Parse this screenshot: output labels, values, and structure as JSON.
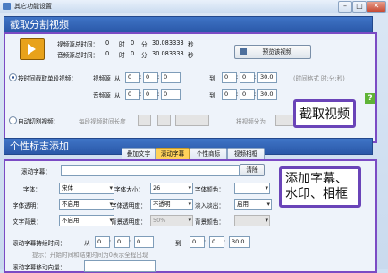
{
  "window": {
    "title": "其它功能设置",
    "min": "–",
    "max": "□",
    "close": "✕"
  },
  "clip": {
    "header": "截取分割视频",
    "video_total_label": "视频源总时间：",
    "video_total": {
      "h": "0",
      "m": "0",
      "s": "30.083333"
    },
    "audio_total_label": "音频源总时间：",
    "audio_total": {
      "h": "0",
      "m": "0",
      "s": "30.083333"
    },
    "unit_h": "时",
    "unit_m": "分",
    "unit_s": "秒",
    "preview_button": "预览该视频",
    "by_time_label": "按时间截取单段视频：",
    "video_src": "视频源",
    "audio_src": "音频源",
    "from": "从",
    "to": "到",
    "video_from": [
      "0",
      "0",
      "0"
    ],
    "video_to": [
      "0",
      "0",
      "30.0"
    ],
    "audio_from": [
      "0",
      "0",
      "0"
    ],
    "audio_to": [
      "0",
      "0",
      "30.0"
    ],
    "time_format_hint": "(时间格式 时:分:秒)",
    "auto_split_label": "自动切割视频：",
    "segment_length_label": "每段视频时间长度",
    "segment_count_label": "将视频分为",
    "segment_unit": "段",
    "callout": "截取视频"
  },
  "logo": {
    "header": "个性标志添加",
    "tabs": [
      "叠加文字",
      "滚动字幕",
      "个性商标",
      "视频相框"
    ],
    "active_tab": 1,
    "scroll_text_label": "滚动字幕：",
    "scroll_text_value": "",
    "clear_button": "清除",
    "font_label": "字体：",
    "font_value": "宋体",
    "size_label": "字体大小：",
    "size_value": "26",
    "color_label": "字体颜色：",
    "alpha_label": "字体透明：",
    "alpha_value": "不启用",
    "alpha_degree_label": "字体透明度：",
    "alpha_degree_value": "不透明",
    "fade_label": "淡入淡出：",
    "fade_value": "启用",
    "bg_label": "文字背景：",
    "bg_value": "不启用",
    "bg_alpha_label": "背景透明度：",
    "bg_alpha_value": "50%",
    "bg_color_label": "背景颜色：",
    "duration_label": "滚动字幕持续时间：",
    "duration_from": [
      "0",
      "0",
      "0"
    ],
    "duration_to": [
      "0",
      "0",
      "30.0"
    ],
    "hint": "提示：开始时间和结束时间为0表示全程出现",
    "speed_label": "滚动字幕移动向量：",
    "callout": "添加字幕、\n水印、相框"
  }
}
